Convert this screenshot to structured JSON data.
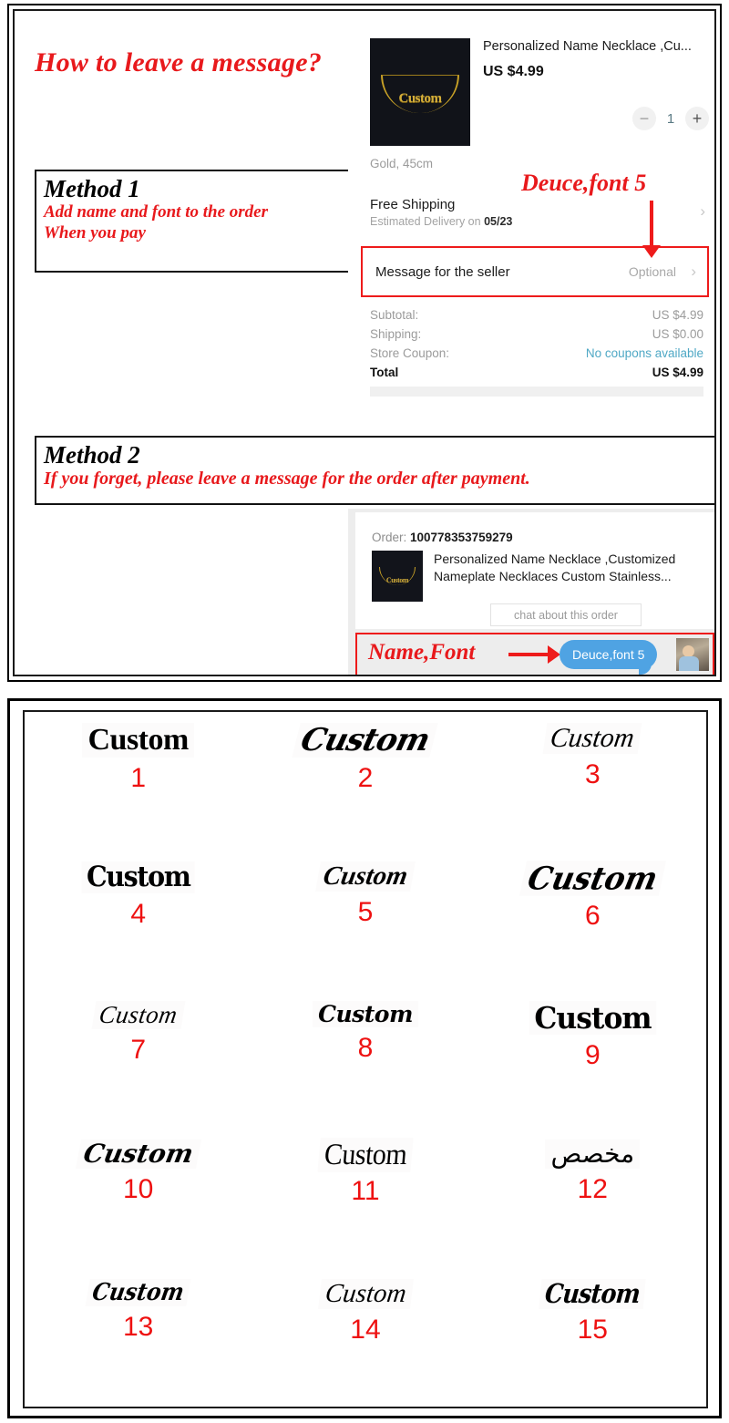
{
  "headline": "How to leave a message?",
  "method1": {
    "title": "Method 1",
    "line1": "Add name and font to the order",
    "line2": "When you pay"
  },
  "method2": {
    "title": "Method 2",
    "line1": "If you forget, please leave a message for the order after payment."
  },
  "annotations": {
    "deuce_font5": "Deuce,font 5",
    "name_font": "Name,Font"
  },
  "checkout": {
    "product_title": "Personalized Name Necklace ,Cu...",
    "price": "US $4.99",
    "thumb_text": "Custom",
    "qty": {
      "minus": "−",
      "value": "1",
      "plus": "+"
    },
    "variant": "Gold, 45cm",
    "shipping_title": "Free Shipping",
    "shipping_sub_prefix": "Estimated Delivery on ",
    "shipping_sub_date": "05/23",
    "message_row": {
      "label": "Message for the seller",
      "value": "Optional",
      "chevron": "›"
    },
    "summary": [
      {
        "key": "Subtotal:",
        "value": "US $4.99",
        "link": false,
        "total": false
      },
      {
        "key": "Shipping:",
        "value": "US $0.00",
        "link": false,
        "total": false
      },
      {
        "key": "Store Coupon:",
        "value": "No coupons available",
        "link": true,
        "total": false
      },
      {
        "key": "Total",
        "value": "US $4.99",
        "link": false,
        "total": true
      }
    ]
  },
  "chat": {
    "order_label": "Order: ",
    "order_number": "100778353759279",
    "product_desc": "Personalized Name Necklace ,Customized Nameplate Necklaces Custom Stainless...",
    "thumb_text": "Custom",
    "chat_button": "chat about this order",
    "bubble_text": "Deuce,font 5"
  },
  "fonts": {
    "samples": [
      {
        "num": "1",
        "text": "Custom",
        "cls": "f1"
      },
      {
        "num": "2",
        "text": "Custom",
        "cls": "f2"
      },
      {
        "num": "3",
        "text": "Custom",
        "cls": "f3"
      },
      {
        "num": "4",
        "text": "Custom",
        "cls": "f4"
      },
      {
        "num": "5",
        "text": "Custom",
        "cls": "f5"
      },
      {
        "num": "6",
        "text": "Custom",
        "cls": "f6"
      },
      {
        "num": "7",
        "text": "Custom",
        "cls": "f7"
      },
      {
        "num": "8",
        "text": "Custom",
        "cls": "f8"
      },
      {
        "num": "9",
        "text": "Custom",
        "cls": "f9"
      },
      {
        "num": "10",
        "text": "Custom",
        "cls": "f10"
      },
      {
        "num": "11",
        "text": "Custom",
        "cls": "f11"
      },
      {
        "num": "12",
        "text": "مخصص",
        "cls": "f12"
      },
      {
        "num": "13",
        "text": "Custom",
        "cls": "f13"
      },
      {
        "num": "14",
        "text": "Custom",
        "cls": "f14"
      },
      {
        "num": "15",
        "text": "Custom",
        "cls": "f15"
      }
    ]
  },
  "colors": {
    "annotation_red": "#e8191c",
    "highlight_red": "#ee1b1b",
    "bubble_blue": "#4fa3e3",
    "link_blue": "#4fa8c5",
    "number_red": "#ee1111"
  }
}
